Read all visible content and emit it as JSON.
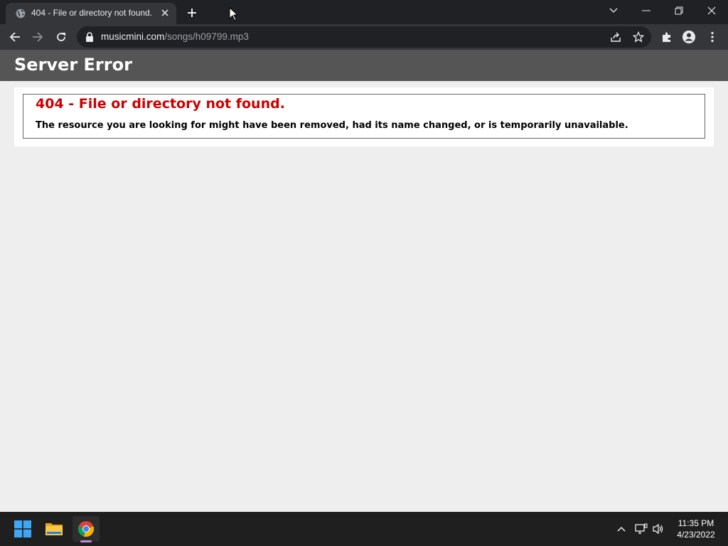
{
  "browser": {
    "tab": {
      "title": "404 - File or directory not found.",
      "favicon": "globe-icon"
    },
    "address": {
      "host": "musicmini.com",
      "path": "/songs/h09799.mp3"
    },
    "colors": {
      "frame": "#202124",
      "toolbar": "#35363a",
      "omnibox": "#202124",
      "text": "#e8eaed",
      "muted": "#9aa0a6"
    }
  },
  "page": {
    "header_title": "Server Error",
    "error_title": "404 - File or directory not found.",
    "error_message": "The resource you are looking for might have been removed, had its name changed, or is temporarily unavailable.",
    "colors": {
      "header_bg": "#555555",
      "error_title": "#cc0000",
      "page_bg": "#eeeeee"
    }
  },
  "taskbar": {
    "apps": [
      "start-icon",
      "file-explorer-icon",
      "chrome-icon"
    ],
    "clock": {
      "time": "11:35 PM",
      "date": "4/23/2022"
    }
  }
}
